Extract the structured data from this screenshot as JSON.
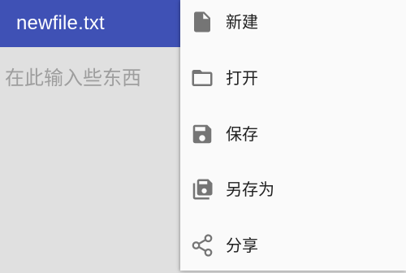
{
  "appbar": {
    "title": "newfile.txt",
    "color": "#3f51b5"
  },
  "editor": {
    "placeholder": "在此输入些东西",
    "value": ""
  },
  "menu": {
    "items": [
      {
        "label": "新建",
        "icon": "new-file-icon"
      },
      {
        "label": "打开",
        "icon": "folder-open-icon"
      },
      {
        "label": "保存",
        "icon": "save-icon"
      },
      {
        "label": "另存为",
        "icon": "save-as-icon"
      },
      {
        "label": "分享",
        "icon": "share-icon"
      }
    ]
  }
}
